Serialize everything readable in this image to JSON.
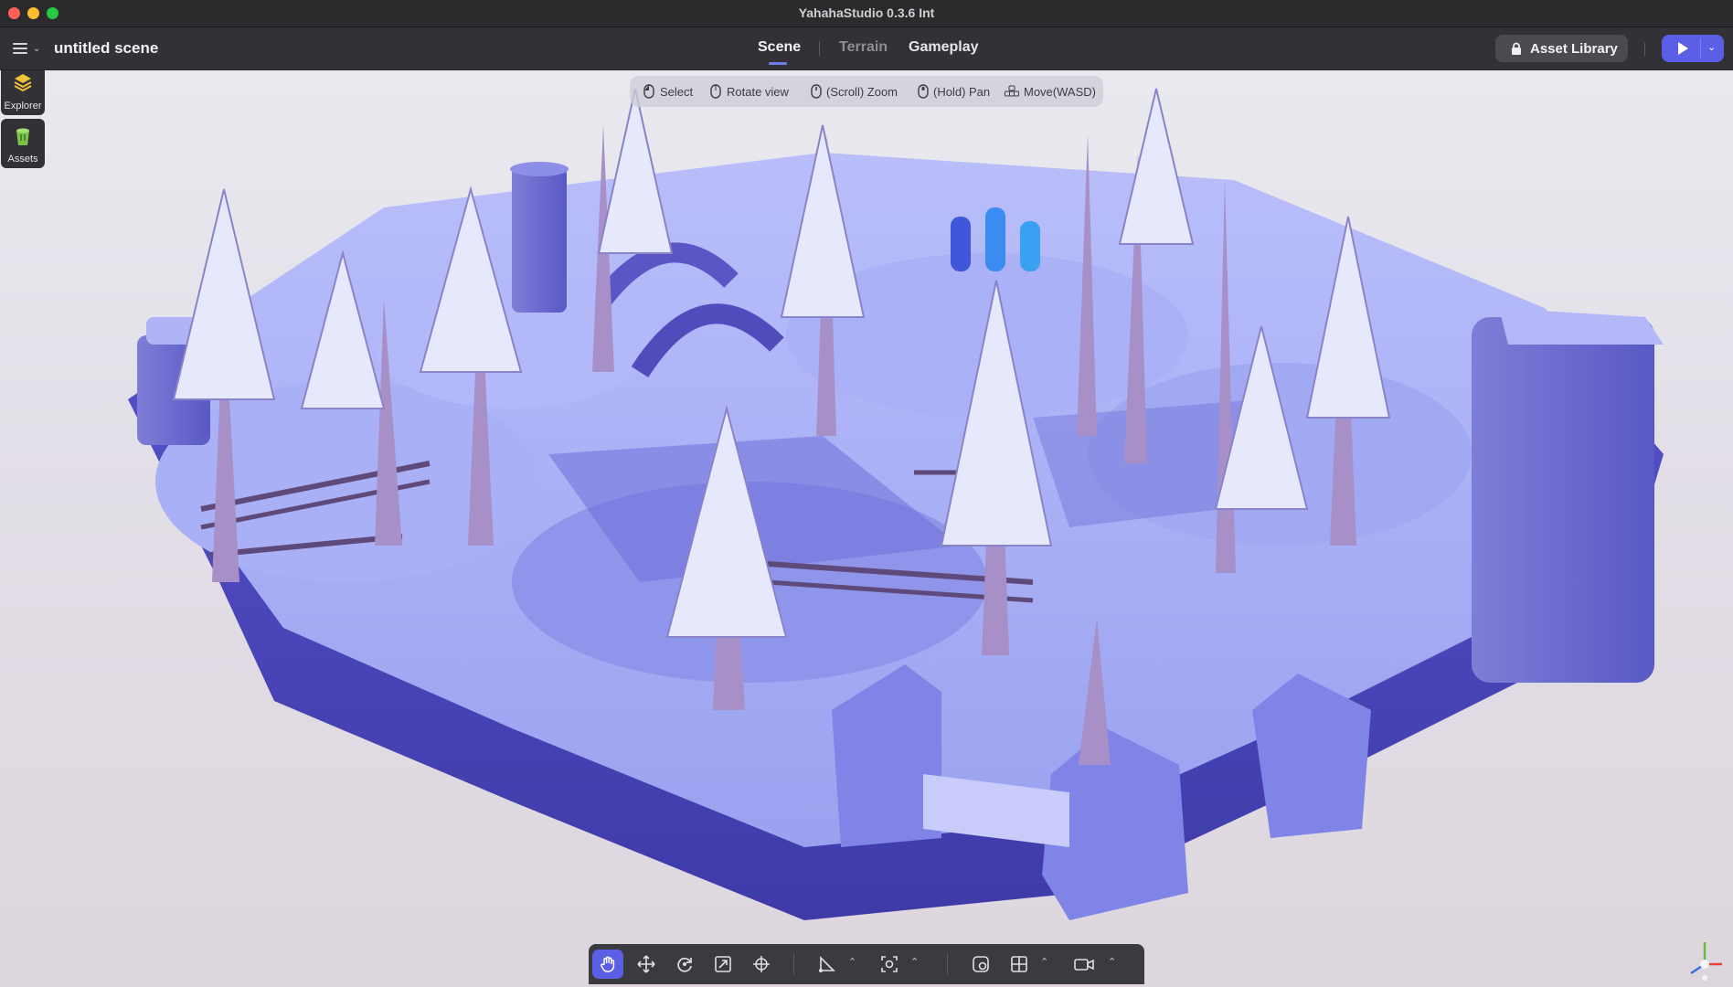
{
  "window": {
    "title": "YahahaStudio 0.3.6 Int"
  },
  "menubar": {
    "scene_name": "untitled scene",
    "tabs": [
      {
        "label": "Scene",
        "active": true
      },
      {
        "label": "Terrain",
        "active": false
      },
      {
        "label": "Gameplay",
        "active": false
      }
    ],
    "asset_library_label": "Asset Library",
    "play_icon": "play-icon"
  },
  "dock": [
    {
      "label": "Explorer",
      "icon": "layers-icon"
    },
    {
      "label": "Assets",
      "icon": "bucket-icon"
    }
  ],
  "controls_hint": [
    {
      "label": "Select",
      "icon": "mouse-left-icon"
    },
    {
      "label": "Rotate view",
      "icon": "mouse-right-icon"
    },
    {
      "label": "(Scroll) Zoom",
      "icon": "mouse-scroll-icon"
    },
    {
      "label": "(Hold) Pan",
      "icon": "mouse-middle-icon"
    },
    {
      "label": "Move(WASD)",
      "icon": "wasd-keys-icon"
    }
  ],
  "toolbar": {
    "tools": [
      "hand-icon",
      "move-icon",
      "rotate-icon",
      "scale-icon",
      "transform-icon",
      "pivot-icon",
      "focus-icon",
      "snap-icon",
      "grid-icon",
      "camera-icon"
    ],
    "active_tool": "hand-icon"
  },
  "colors": {
    "accent": "#5b5fe6",
    "chrome_dark": "#323236",
    "scene_snow": "#9aa2f0",
    "scene_shadow": "#4a46b8",
    "tree_trunk": "#a790c8"
  }
}
